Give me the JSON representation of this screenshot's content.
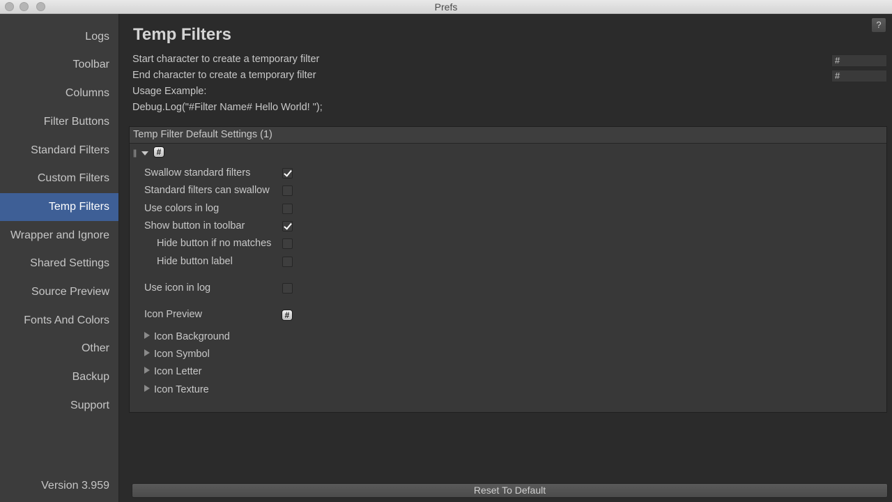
{
  "window": {
    "title": "Prefs"
  },
  "sidebar": {
    "items": [
      {
        "label": "Logs",
        "active": false
      },
      {
        "label": "Toolbar",
        "active": false
      },
      {
        "label": "Columns",
        "active": false
      },
      {
        "label": "Filter Buttons",
        "active": false
      },
      {
        "label": "Standard Filters",
        "active": false
      },
      {
        "label": "Custom Filters",
        "active": false
      },
      {
        "label": "Temp Filters",
        "active": true
      },
      {
        "label": "Wrapper and Ignore",
        "active": false
      },
      {
        "label": "Shared Settings",
        "active": false
      },
      {
        "label": "Source Preview",
        "active": false
      },
      {
        "label": "Fonts And Colors",
        "active": false
      },
      {
        "label": "Other",
        "active": false
      },
      {
        "label": "Backup",
        "active": false
      },
      {
        "label": "Support",
        "active": false
      }
    ],
    "version": "Version 3.959"
  },
  "main": {
    "help_label": "?",
    "title": "Temp Filters",
    "start_char_label": "Start character to create a temporary filter",
    "start_char_value": "#",
    "end_char_label": "End character to create a temporary filter",
    "end_char_value": "#",
    "usage_label": "Usage Example:",
    "usage_code": "Debug.Log(\"#Filter Name# Hello World! \");",
    "panel": {
      "header": "Temp Filter Default Settings (1)",
      "grip": "||",
      "selected_icon": "#",
      "options": [
        {
          "label": "Swallow standard filters",
          "checked": true
        },
        {
          "label": "Standard filters can swallow",
          "checked": false
        },
        {
          "label": "Use colors in log",
          "checked": false
        },
        {
          "label": "Show button in toolbar",
          "checked": true
        },
        {
          "label": "Hide button if no matches",
          "checked": false
        },
        {
          "label": "Hide button label",
          "checked": false
        },
        {
          "label": "Use icon in log",
          "checked": false
        }
      ],
      "icon_preview_label": "Icon Preview",
      "icon_preview_symbol": "#",
      "foldouts": [
        "Icon Background",
        "Icon Symbol",
        "Icon Letter",
        "Icon Texture"
      ]
    },
    "reset_label": "Reset To Default"
  },
  "colors": {
    "active_nav": "#3e5f96",
    "background": "#2b2b2b",
    "sidebar": "#3c3c3c"
  }
}
